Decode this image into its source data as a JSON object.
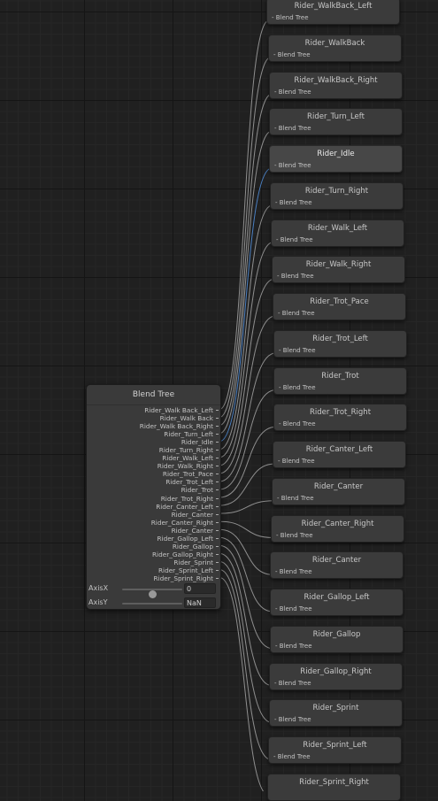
{
  "main_node": {
    "title": "Blend Tree",
    "slots": [
      "Rider_Walk Back_Left",
      "Rider_Walk Back",
      "Rider_Walk Back_Right",
      "Rider_Turn_Left",
      "Rider_Idle",
      "Rider_Turn_Right",
      "Rider_Walk_Left",
      "Rider_Walk_Right",
      "Rider_Trot_Pace",
      "Rider_Trot_Left",
      "Rider_Trot",
      "Rider_Trot_Right",
      "Rider_Canter_Left",
      "Rider_Canter",
      "Rider_Canter_Right",
      "Rider_Canter",
      "Rider_Gallop_Left",
      "Rider_Gallop",
      "Rider_Gallop_Right",
      "Rider_Sprint",
      "Rider_Sprint_Left",
      "Rider_Sprint_Right"
    ],
    "axis_x": {
      "label": "AxisX",
      "value": "0",
      "slider_level": 0.5
    },
    "axis_y": {
      "label": "AxisY",
      "value": "NaN"
    }
  },
  "child_nodes": [
    {
      "name": "Rider_WalkBack_Left",
      "subtitle": "Blend Tree"
    },
    {
      "name": "Rider_WalkBack",
      "subtitle": "Blend Tree"
    },
    {
      "name": "Rider_WalkBack_Right",
      "subtitle": "Blend Tree"
    },
    {
      "name": "Rider_Turn_Left",
      "subtitle": "Blend Tree"
    },
    {
      "name": "Rider_Idle",
      "subtitle": "Blend Tree",
      "selected": true
    },
    {
      "name": "Rider_Turn_Right",
      "subtitle": "Blend Tree"
    },
    {
      "name": "Rider_Walk_Left",
      "subtitle": "Blend Tree"
    },
    {
      "name": "Rider_Walk_Right",
      "subtitle": "Blend Tree"
    },
    {
      "name": "Rider_Trot_Pace",
      "subtitle": "Blend Tree"
    },
    {
      "name": "Rider_Trot_Left",
      "subtitle": "Blend Tree"
    },
    {
      "name": "Rider_Trot",
      "subtitle": "Blend Tree"
    },
    {
      "name": "Rider_Trot_Right",
      "subtitle": "Blend Tree"
    },
    {
      "name": "Rider_Canter_Left",
      "subtitle": "Blend Tree"
    },
    {
      "name": "Rider_Canter",
      "subtitle": "Blend Tree"
    },
    {
      "name": "Rider_Canter_Right",
      "subtitle": "Blend Tree"
    },
    {
      "name": "Rider_Canter",
      "subtitle": "Blend Tree"
    },
    {
      "name": "Rider_Gallop_Left",
      "subtitle": "Blend Tree"
    },
    {
      "name": "Rider_Gallop",
      "subtitle": "Blend Tree"
    },
    {
      "name": "Rider_Gallop_Right",
      "subtitle": "Blend Tree"
    },
    {
      "name": "Rider_Sprint",
      "subtitle": "Blend Tree"
    },
    {
      "name": "Rider_Sprint_Left",
      "subtitle": "Blend Tree"
    },
    {
      "name": "Rider_Sprint_Right",
      "subtitle": ""
    }
  ],
  "colors": {
    "wire": "#8f8f8f",
    "wire_selected": "#4a7fc1"
  }
}
